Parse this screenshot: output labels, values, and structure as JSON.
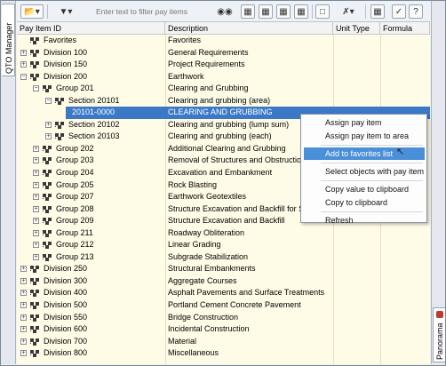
{
  "palette": "QTO Manager",
  "side_panel": "Panorama",
  "filter": {
    "placeholder": "Enter text to filter pay items",
    "value": ""
  },
  "columns": [
    "Pay Item ID",
    "Description",
    "Unit Type",
    "Formula"
  ],
  "rows": [
    {
      "id": "Favorites",
      "desc": "Favorites",
      "level": 0,
      "expander": "none",
      "kind": "folder"
    },
    {
      "id": "Division 100",
      "desc": "General Requirements",
      "level": 0,
      "expander": "plus",
      "kind": "folder"
    },
    {
      "id": "Division 150",
      "desc": "Project Requirements",
      "level": 0,
      "expander": "plus",
      "kind": "folder"
    },
    {
      "id": "Division 200",
      "desc": "Earthwork",
      "level": 0,
      "expander": "minus",
      "kind": "folder"
    },
    {
      "id": "Group 201",
      "desc": "Clearing and Grubbing",
      "level": 1,
      "expander": "minus",
      "kind": "folder"
    },
    {
      "id": "Section 20101",
      "desc": "Clearing and grubbing (area)",
      "level": 2,
      "expander": "minus",
      "kind": "folder"
    },
    {
      "id": "20101-0000",
      "desc": "CLEARING AND GRUBBING",
      "level": 3,
      "expander": "none",
      "kind": "item",
      "selected": true
    },
    {
      "id": "Section 20102",
      "desc": "Clearing and grubbing (lump sum)",
      "level": 2,
      "expander": "plus",
      "kind": "folder"
    },
    {
      "id": "Section 20103",
      "desc": "Clearing and grubbing (each)",
      "level": 2,
      "expander": "plus",
      "kind": "folder"
    },
    {
      "id": "Group 202",
      "desc": "Additional Clearing and Grubbing",
      "level": 1,
      "expander": "plus",
      "kind": "folder"
    },
    {
      "id": "Group 203",
      "desc": "Removal of Structures and Obstructions",
      "level": 1,
      "expander": "plus",
      "kind": "folder"
    },
    {
      "id": "Group 204",
      "desc": "Excavation and Embankment",
      "level": 1,
      "expander": "plus",
      "kind": "folder"
    },
    {
      "id": "Group 205",
      "desc": "Rock Blasting",
      "level": 1,
      "expander": "plus",
      "kind": "folder"
    },
    {
      "id": "Group 207",
      "desc": "Earthwork Geotextiles",
      "level": 1,
      "expander": "plus",
      "kind": "folder"
    },
    {
      "id": "Group 208",
      "desc": "Structure Excavation and Backfill for Sele",
      "level": 1,
      "expander": "plus",
      "kind": "folder"
    },
    {
      "id": "Group 209",
      "desc": "Structure Excavation and Backfill",
      "level": 1,
      "expander": "plus",
      "kind": "folder"
    },
    {
      "id": "Group 211",
      "desc": "Roadway Obliteration",
      "level": 1,
      "expander": "plus",
      "kind": "folder"
    },
    {
      "id": "Group 212",
      "desc": "Linear Grading",
      "level": 1,
      "expander": "plus",
      "kind": "folder"
    },
    {
      "id": "Group 213",
      "desc": "Subgrade Stabilization",
      "level": 1,
      "expander": "plus",
      "kind": "folder"
    },
    {
      "id": "Division 250",
      "desc": "Structural Embankments",
      "level": 0,
      "expander": "plus",
      "kind": "folder"
    },
    {
      "id": "Division 300",
      "desc": "Aggregate Courses",
      "level": 0,
      "expander": "plus",
      "kind": "folder"
    },
    {
      "id": "Division 400",
      "desc": "Asphalt Pavements and Surface Treatments",
      "level": 0,
      "expander": "plus",
      "kind": "folder"
    },
    {
      "id": "Division 500",
      "desc": "Portland Cement Concrete Pavement",
      "level": 0,
      "expander": "plus",
      "kind": "folder"
    },
    {
      "id": "Division 550",
      "desc": "Bridge Construction",
      "level": 0,
      "expander": "plus",
      "kind": "folder"
    },
    {
      "id": "Division 600",
      "desc": "Incidental Construction",
      "level": 0,
      "expander": "plus",
      "kind": "folder"
    },
    {
      "id": "Division 700",
      "desc": "Material",
      "level": 0,
      "expander": "plus",
      "kind": "folder"
    },
    {
      "id": "Division 800",
      "desc": "Miscellaneous",
      "level": 0,
      "expander": "plus",
      "kind": "folder"
    }
  ],
  "context_menu": [
    {
      "label": "Assign pay item",
      "highlighted": false
    },
    {
      "label": "Assign pay item to area",
      "highlighted": false
    },
    {
      "separator": true
    },
    {
      "label": "Add to favorites list",
      "highlighted": true
    },
    {
      "separator": true
    },
    {
      "label": "Select objects with pay item",
      "highlighted": false
    },
    {
      "separator": true
    },
    {
      "label": "Copy value to clipboard",
      "highlighted": false
    },
    {
      "label": "Copy to clipboard",
      "highlighted": false
    },
    {
      "separator": true
    },
    {
      "label": "Refresh",
      "highlighted": false
    }
  ],
  "colors": {
    "selection": "#3b79c7",
    "menu_highlight": "#4a90d9",
    "grid_bg": "#fefbe6"
  }
}
